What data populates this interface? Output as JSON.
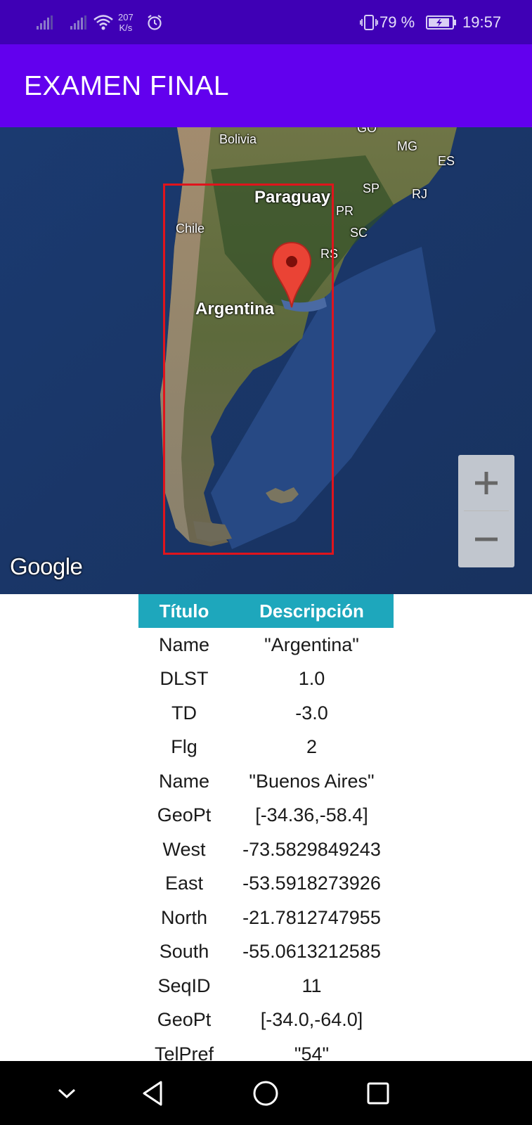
{
  "status_bar": {
    "net_speed_value": "207",
    "net_speed_unit": "K/s",
    "battery_percent": "79 %",
    "time": "19:57",
    "icons": [
      "signal-icon",
      "signal-icon",
      "wifi-icon",
      "alarm-icon",
      "vibrate-icon",
      "battery-icon"
    ]
  },
  "app_bar": {
    "title": "EXAMEN FINAL",
    "color": "#6200ee"
  },
  "map": {
    "labels": {
      "bolivia": "Bolivia",
      "go": "GO",
      "mg": "MG",
      "es": "ES",
      "paraguay": "Paraguay",
      "sp": "SP",
      "rj": "RJ",
      "pr": "PR",
      "chile": "Chile",
      "sc": "SC",
      "rs": "RS",
      "argentina": "Argentina"
    },
    "bounds_color": "#e0141c",
    "marker_color": "#ea4335",
    "zoom_in": "+",
    "zoom_out": "−",
    "attribution": "Google"
  },
  "table": {
    "header": {
      "col1": "Título",
      "col2": "Descripción"
    },
    "header_color": "#1ea7bc",
    "rows": [
      {
        "title": "Name",
        "value": "\"Argentina\""
      },
      {
        "title": "DLST",
        "value": "1.0"
      },
      {
        "title": "TD",
        "value": "-3.0"
      },
      {
        "title": "Flg",
        "value": "2"
      },
      {
        "title": "Name",
        "value": "\"Buenos Aires\""
      },
      {
        "title": "GeoPt",
        "value": "[-34.36,-58.4]"
      },
      {
        "title": "West",
        "value": "-73.5829849243"
      },
      {
        "title": "East",
        "value": "-53.5918273926"
      },
      {
        "title": "North",
        "value": "-21.7812747955"
      },
      {
        "title": "South",
        "value": "-55.0613212585"
      },
      {
        "title": "SeqID",
        "value": "11"
      },
      {
        "title": "GeoPt",
        "value": "[-34.0,-64.0]"
      },
      {
        "title": "TelPref",
        "value": "\"54\""
      }
    ]
  },
  "nav_bar": {
    "icons": [
      "collapse-icon",
      "back-icon",
      "home-icon",
      "recents-icon"
    ]
  }
}
